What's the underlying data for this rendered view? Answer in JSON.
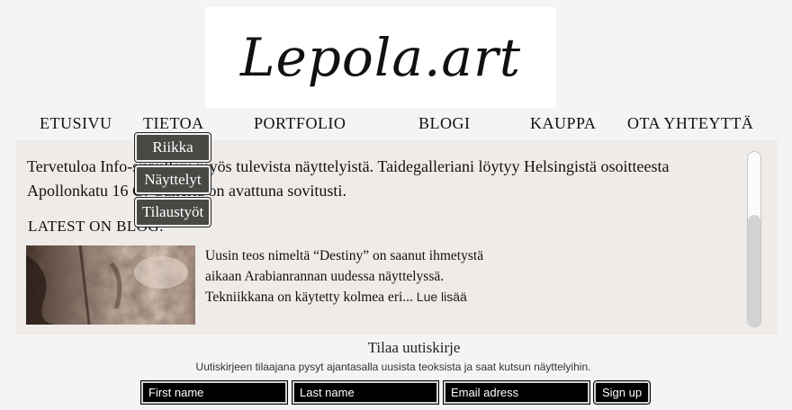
{
  "header": {
    "logo_text": "Lepola.art"
  },
  "nav": {
    "items": [
      {
        "label": "ETUSIVU"
      },
      {
        "label": "TIETOA"
      },
      {
        "label": "PORTFOLIO"
      },
      {
        "label": "BLOGI"
      },
      {
        "label": "KAUPPA"
      },
      {
        "label": "OTA YHTEYTTÄ"
      }
    ],
    "dropdown": [
      {
        "label": "Riikka"
      },
      {
        "label": "Näyttelyt"
      },
      {
        "label": "Tilaustyöt"
      }
    ]
  },
  "main": {
    "intro": "Tervetuloa Info-sivuillani myös tulevista näyttelyistä. Taidegalleriani löytyy Helsingistä osoitteesta Apollonkatu 16 G. Galleria on avattuna sovitusti.",
    "latest_heading": "LATEST ON BLOG:",
    "post": {
      "excerpt": "Uusin teos nimeltä “Destiny”  on saanut ihmetystä aikaan Arabianrannan uudessa näyttelyssä. Tekniikkana on käytetty kolmea eri...",
      "read_more": "Lue lisää"
    }
  },
  "newsletter": {
    "title": "Tilaa uutiskirje",
    "subtitle": "Uutiskirjeen tilaajana pysyt ajantasalla uusista teoksista ja saat kutsun näyttelyihin.",
    "first_name_placeholder": "First name",
    "last_name_placeholder": "Last name",
    "email_placeholder": "Email adress",
    "signup_label": "Sign up"
  }
}
